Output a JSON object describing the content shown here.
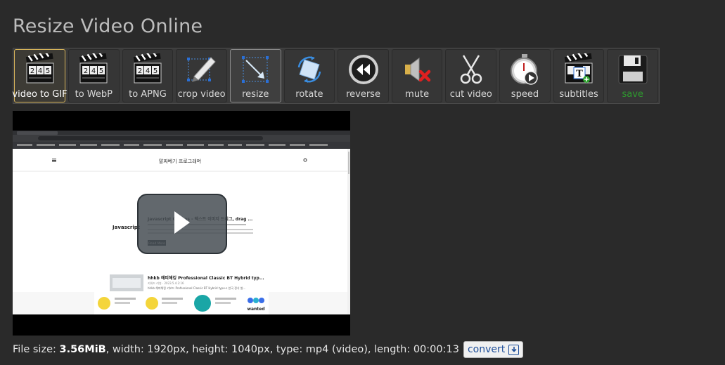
{
  "page": {
    "title": "Resize Video Online"
  },
  "toolbar": {
    "items": [
      {
        "label": "video to GIF",
        "icon": "clapperboard-icon"
      },
      {
        "label": "to WebP",
        "icon": "clapperboard-icon"
      },
      {
        "label": "to APNG",
        "icon": "clapperboard-icon"
      },
      {
        "label": "crop video",
        "icon": "crop-pen-icon"
      },
      {
        "label": "resize",
        "icon": "resize-icon"
      },
      {
        "label": "rotate",
        "icon": "rotate-icon"
      },
      {
        "label": "reverse",
        "icon": "rewind-icon"
      },
      {
        "label": "mute",
        "icon": "speaker-mute-icon"
      },
      {
        "label": "cut video",
        "icon": "scissors-icon"
      },
      {
        "label": "speed",
        "icon": "stopwatch-icon"
      },
      {
        "label": "subtitles",
        "icon": "clapperboard-subtitles-icon"
      },
      {
        "label": "save",
        "icon": "floppy-disk-icon"
      }
    ],
    "clapper_numbers": [
      "2",
      "4",
      "5"
    ]
  },
  "video": {
    "site_title": "말짜베기 프로그래머",
    "post_title": "Javascript Canvas - 텍스트 이미지 드리그, drag ...",
    "post2_title": "hhkb 해피해킹 Professional Classic BT Hybrid typ...",
    "post2_meta": "키워드 리뷰 · 2023.5.4.2:16",
    "post2_desc": "hhkb 해피해킹 키보드 Professional Classic BT Hybrid type-s 한국 정식 발...",
    "read_more": "Read More",
    "ad_brand": "wanted"
  },
  "info": {
    "file_size_label": "File size:",
    "file_size": "3.56MiB",
    "rest": ", width: 1920px, height: 1040px, type: mp4 (video), length: 00:00:13",
    "convert_label": "convert"
  },
  "colors": {
    "background": "#2a2a2a",
    "active_border": "#d7b45a",
    "save_green": "#2e9a2e",
    "link_blue": "#1f4f9a"
  }
}
